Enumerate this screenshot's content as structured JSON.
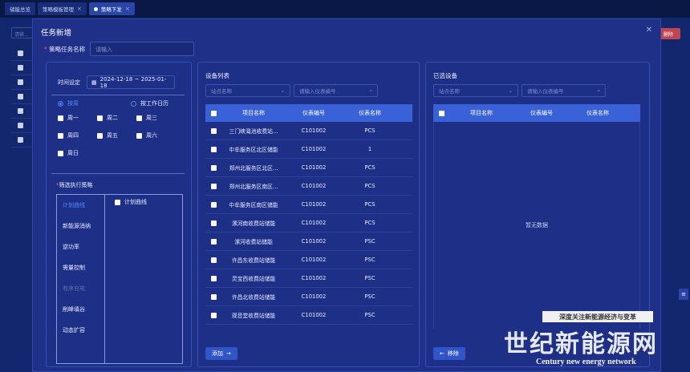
{
  "top_tabs": [
    {
      "label": "储能总览"
    },
    {
      "label": "策略模板管理"
    },
    {
      "label": "策略下发"
    }
  ],
  "background": {
    "search_placeholder": "请输...",
    "danger_button": "删除"
  },
  "modal": {
    "title": "任务新增",
    "name_label": "策略任务名称",
    "name_placeholder": "请输入",
    "left": {
      "time_label": "时间设定",
      "date_range": "2024-12-18  ~  2025-01-18",
      "mode_week": "按周",
      "mode_workday": "按工作日历",
      "days": [
        "周一",
        "周二",
        "周三",
        "周四",
        "周五",
        "周六",
        "周日"
      ],
      "strategy_label": "筛选执行策略",
      "strategies": [
        "计划曲线",
        "新能源消纳",
        "逆功率",
        "需量控制",
        "有序充电",
        "削峰填谷",
        "动态扩容"
      ],
      "strategy_option": "计划曲线"
    },
    "middle": {
      "title": "设备列表",
      "station_placeholder": "站点名称",
      "instrument_placeholder": "请输入仪表编号",
      "columns": [
        "项目名称",
        "仪表编号",
        "仪表名称"
      ],
      "rows": [
        [
          "三门峡渑池收费站...",
          "C101002",
          "PCS"
        ],
        [
          "中牟服务区北区储能",
          "C101002",
          "1"
        ],
        [
          "郑州北服务区北区...",
          "C101002",
          "PCS"
        ],
        [
          "郑州北服务区南区...",
          "C101002",
          "PCS"
        ],
        [
          "中牟服务区南区储能",
          "C101002",
          "PCS"
        ],
        [
          "漯河南收费站储能",
          "C101002",
          "PCS"
        ],
        [
          "漯河收费站储能",
          "C101002",
          "PSC"
        ],
        [
          "许昌东收费站储能",
          "C101002",
          "PSC"
        ],
        [
          "灵宝西收费站储能",
          "C101002",
          "PSC"
        ],
        [
          "许昌北收费站储能",
          "C101002",
          "PSC"
        ],
        [
          "观音堂收费站储能",
          "C101002",
          "PSC"
        ]
      ],
      "add_button": "添加"
    },
    "right": {
      "title": "已选设备",
      "station_placeholder": "站点名称",
      "instrument_placeholder": "请输入仪表编号",
      "columns": [
        "项目名称",
        "仪表编号",
        "仪表名称"
      ],
      "empty_text": "暂无数据",
      "remove_button": "移除"
    }
  },
  "watermark": {
    "slogan": "深度关注新能源经济与变革",
    "name": "世纪新能源网",
    "english": "Century new energy network"
  }
}
